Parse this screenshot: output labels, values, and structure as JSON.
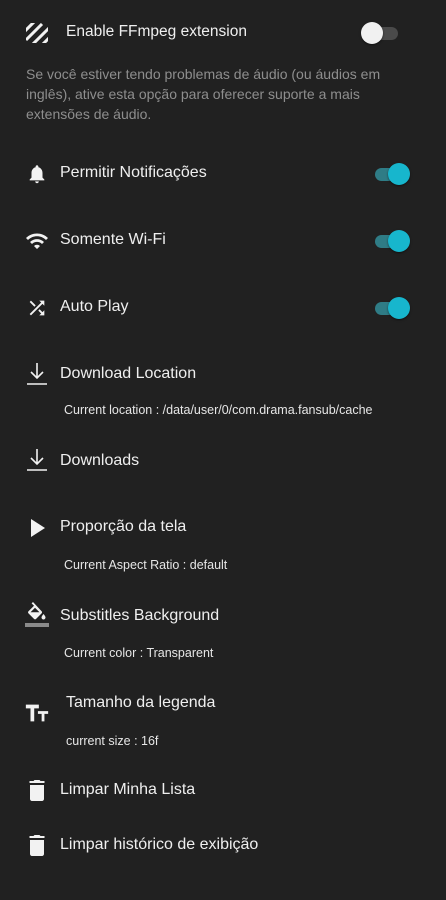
{
  "ffmpeg": {
    "title": "Enable FFmpeg extension",
    "description": "Se você estiver tendo problemas de áudio (ou áudios em inglês), ative esta opção para oferecer suporte a mais extensões de áudio.",
    "enabled": false,
    "icon": "stripes-icon"
  },
  "notifications": {
    "title": "Permitir Notificações",
    "enabled": true,
    "icon": "bell-icon"
  },
  "wifi": {
    "title": "Somente Wi-Fi",
    "enabled": true,
    "icon": "wifi-icon"
  },
  "autoplay": {
    "title": "Auto Play",
    "enabled": true,
    "icon": "shuffle-icon"
  },
  "download_location": {
    "title": "Download Location",
    "subtitle": "Current location : /data/user/0/com.drama.fansub/cache",
    "icon": "download-icon"
  },
  "downloads": {
    "title": "Downloads",
    "icon": "download-icon"
  },
  "aspect_ratio": {
    "title": "Proporção da tela",
    "subtitle": "Current Aspect Ratio : default",
    "icon": "play-icon"
  },
  "subtitle_bg": {
    "title": "Substitles Background",
    "subtitle": "Current color : Transparent",
    "icon": "paint-bucket-icon"
  },
  "subtitle_size": {
    "title": "Tamanho da legenda",
    "subtitle": "current size : 16f",
    "icon": "text-size-icon"
  },
  "clear_list": {
    "title": "Limpar Minha Lista",
    "icon": "trash-icon"
  },
  "clear_history": {
    "title": "Limpar histórico de exibição",
    "icon": "trash-icon"
  },
  "colors": {
    "background": "#212121",
    "accent": "#17b6cd",
    "accent_track": "#2f7c86",
    "description": "#8e8e8e"
  }
}
